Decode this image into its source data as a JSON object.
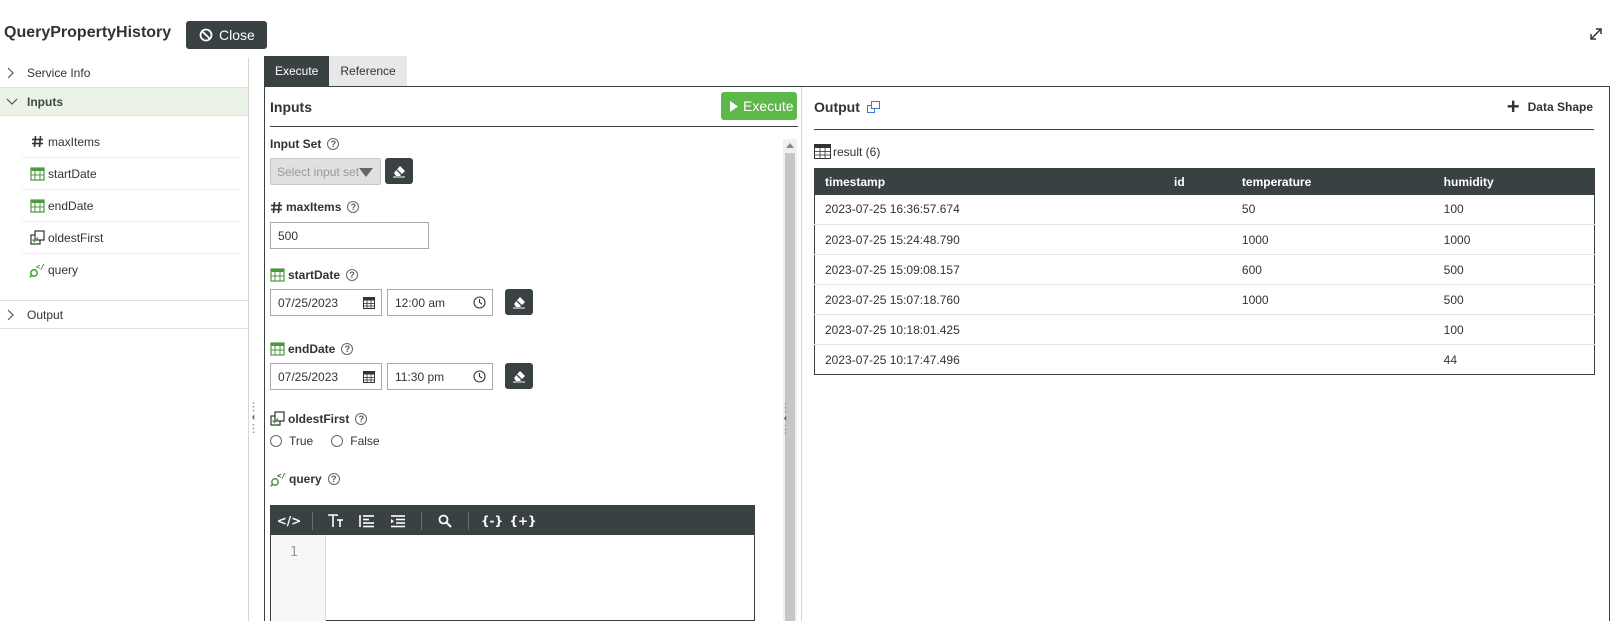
{
  "header": {
    "title": "QueryPropertyHistory",
    "close_label": "Close"
  },
  "sidebar": {
    "service_info": "Service Info",
    "inputs": "Inputs",
    "items": [
      {
        "label": "maxItems",
        "icon": "number-icon"
      },
      {
        "label": "startDate",
        "icon": "calendar-icon"
      },
      {
        "label": "endDate",
        "icon": "calendar-icon"
      },
      {
        "label": "oldestFirst",
        "icon": "boolean-icon"
      },
      {
        "label": "query",
        "icon": "query-icon"
      }
    ],
    "output": "Output"
  },
  "tabs": [
    {
      "label": "Execute",
      "active": true
    },
    {
      "label": "Reference",
      "active": false
    }
  ],
  "inputs_panel": {
    "title": "Inputs",
    "execute_label": "Execute",
    "input_set_label": "Input Set",
    "input_set_placeholder": "Select input set",
    "max_items_label": "maxItems",
    "max_items_value": "500",
    "start_date_label": "startDate",
    "start_date": "07/25/2023",
    "start_time": "12:00 am",
    "end_date_label": "endDate",
    "end_date": "07/25/2023",
    "end_time": "11:30 pm",
    "oldest_first_label": "oldestFirst",
    "option_true": "True",
    "option_false": "False",
    "query_label": "query",
    "editor_line": "1"
  },
  "output_panel": {
    "title": "Output",
    "data_shape_label": "Data Shape",
    "result_label": "result (6)",
    "columns": [
      "timestamp",
      "id",
      "temperature",
      "humidity"
    ],
    "rows": [
      [
        "2023-07-25 16:36:57.674",
        "",
        "50",
        "100"
      ],
      [
        "2023-07-25 15:24:48.790",
        "",
        "1000",
        "1000"
      ],
      [
        "2023-07-25 15:09:08.157",
        "",
        "600",
        "500"
      ],
      [
        "2023-07-25 15:07:18.760",
        "",
        "1000",
        "500"
      ],
      [
        "2023-07-25 10:18:01.425",
        "",
        "",
        "100"
      ],
      [
        "2023-07-25 10:17:47.496",
        "",
        "",
        "44"
      ]
    ]
  },
  "colors": {
    "dark": "#3a4143",
    "execute_green": "#5bb849",
    "active_section": "#eaf3e6",
    "icon_green": "#4a9a3e"
  }
}
